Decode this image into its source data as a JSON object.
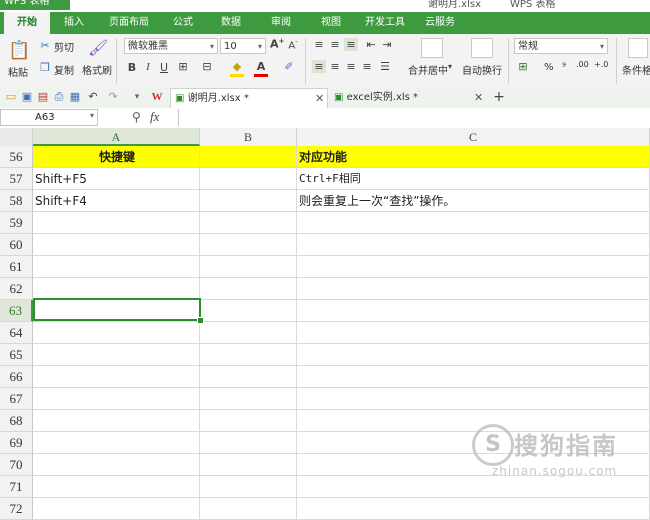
{
  "app": {
    "badge": "WPS 表格",
    "title_doc": "谢明月.xlsx",
    "title_app": "WPS 表格"
  },
  "menu": [
    "开始",
    "插入",
    "页面布局",
    "公式",
    "数据",
    "审阅",
    "视图",
    "开发工具",
    "云服务"
  ],
  "ribbon": {
    "paste": "粘贴",
    "cut": "剪切",
    "copy": "复制",
    "format_painter": "格式刷",
    "font_name": "微软雅黑",
    "font_size": "10",
    "bold": "B",
    "italic": "I",
    "underline": "U",
    "merge_center": "合并居中",
    "wrap_text": "自动换行",
    "number_format": "常规",
    "percent": "%",
    "comma": "⁹",
    "dec_inc": ".00",
    "dec_dec": "+.0",
    "cond_format": "条件格"
  },
  "tabs": [
    {
      "label": "谢明月.xlsx *",
      "active": true
    },
    {
      "label": "excel实例.xls *",
      "active": false
    }
  ],
  "formula_bar": {
    "cell_ref": "A63",
    "fx": "fx",
    "value": ""
  },
  "columns": [
    "A",
    "B",
    "C"
  ],
  "rows": [
    {
      "num": "56",
      "a": "快捷键",
      "b": "",
      "c": "对应功能",
      "header": true
    },
    {
      "num": "57",
      "a": "Shift+F5",
      "b": "",
      "c": "Ctrl+F相同"
    },
    {
      "num": "58",
      "a": "Shift+F4",
      "b": "",
      "c": "则会重复上一次“查找”操作。"
    },
    {
      "num": "59",
      "a": "",
      "b": "",
      "c": ""
    },
    {
      "num": "60",
      "a": "",
      "b": "",
      "c": ""
    },
    {
      "num": "61",
      "a": "",
      "b": "",
      "c": ""
    },
    {
      "num": "62",
      "a": "",
      "b": "",
      "c": ""
    },
    {
      "num": "63",
      "a": "",
      "b": "",
      "c": "",
      "selected": true
    },
    {
      "num": "64",
      "a": "",
      "b": "",
      "c": ""
    },
    {
      "num": "65",
      "a": "",
      "b": "",
      "c": ""
    },
    {
      "num": "66",
      "a": "",
      "b": "",
      "c": ""
    },
    {
      "num": "67",
      "a": "",
      "b": "",
      "c": ""
    },
    {
      "num": "68",
      "a": "",
      "b": "",
      "c": ""
    },
    {
      "num": "69",
      "a": "",
      "b": "",
      "c": ""
    },
    {
      "num": "70",
      "a": "",
      "b": "",
      "c": ""
    },
    {
      "num": "71",
      "a": "",
      "b": "",
      "c": ""
    },
    {
      "num": "72",
      "a": "",
      "b": "",
      "c": ""
    }
  ],
  "watermark": {
    "main": "搜狗指南",
    "sub": "zhinan.sogou.com",
    "logo": "S"
  },
  "colors": {
    "accent": "#3e9a3f",
    "header_fill": "#ffff00",
    "selection": "#2f8c2f"
  }
}
